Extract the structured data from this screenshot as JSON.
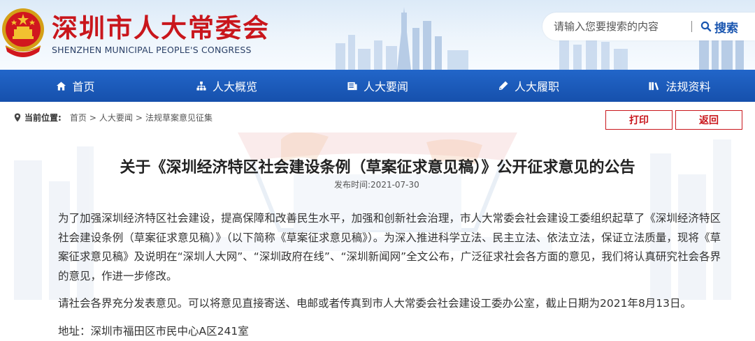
{
  "site": {
    "title": "深圳市人大常委会",
    "subtitle": "SHENZHEN MUNICIPAL PEOPLE'S CONGRESS",
    "brand_color": "#c9161c",
    "nav_color": "#1e5fc0"
  },
  "search": {
    "placeholder": "请输入您要搜索的内容",
    "button_label": "搜索",
    "icon": "search-icon"
  },
  "nav": {
    "items": [
      {
        "label": "首页",
        "icon": "home-icon"
      },
      {
        "label": "人大概览",
        "icon": "org-chart-icon"
      },
      {
        "label": "人大要闻",
        "icon": "news-icon"
      },
      {
        "label": "人大履职",
        "icon": "pen-icon"
      },
      {
        "label": "法规资料",
        "icon": "books-icon"
      }
    ]
  },
  "breadcrumb": {
    "label": "当前位置:",
    "items": [
      "首页",
      "人大要闻",
      "法规草案意见征集"
    ],
    "separator": ">"
  },
  "actions": {
    "print_label": "打印",
    "back_label": "返回"
  },
  "article": {
    "title": "关于《深圳经济特区社会建设条例（草案征求意见稿）》公开征求意见的公告",
    "publish_label": "发布时间:",
    "publish_date": "2021-07-30",
    "paragraphs": [
      "为了加强深圳经济特区社会建设，提高保障和改善民生水平，加强和创新社会治理，市人大常委会社会建设工委组织起草了《深圳经济特区社会建设条例（草案征求意见稿）》（以下简称《草案征求意见稿》）。为深入推进科学立法、民主立法、依法立法，保证立法质量，现将《草案征求意见稿》及说明在“深圳人大网”、“深圳政府在线”、“深圳新闻网”全文公布，广泛征求社会各方面的意见，我们将认真研究社会各界的意见，作进一步修改。",
      "请社会各界充分发表意见。可以将意见直接寄送、电邮或者传真到市人大常委会社会建设工委办公室，截止日期为2021年8月13日。",
      "地址：深圳市福田区市民中心A区241室"
    ]
  }
}
